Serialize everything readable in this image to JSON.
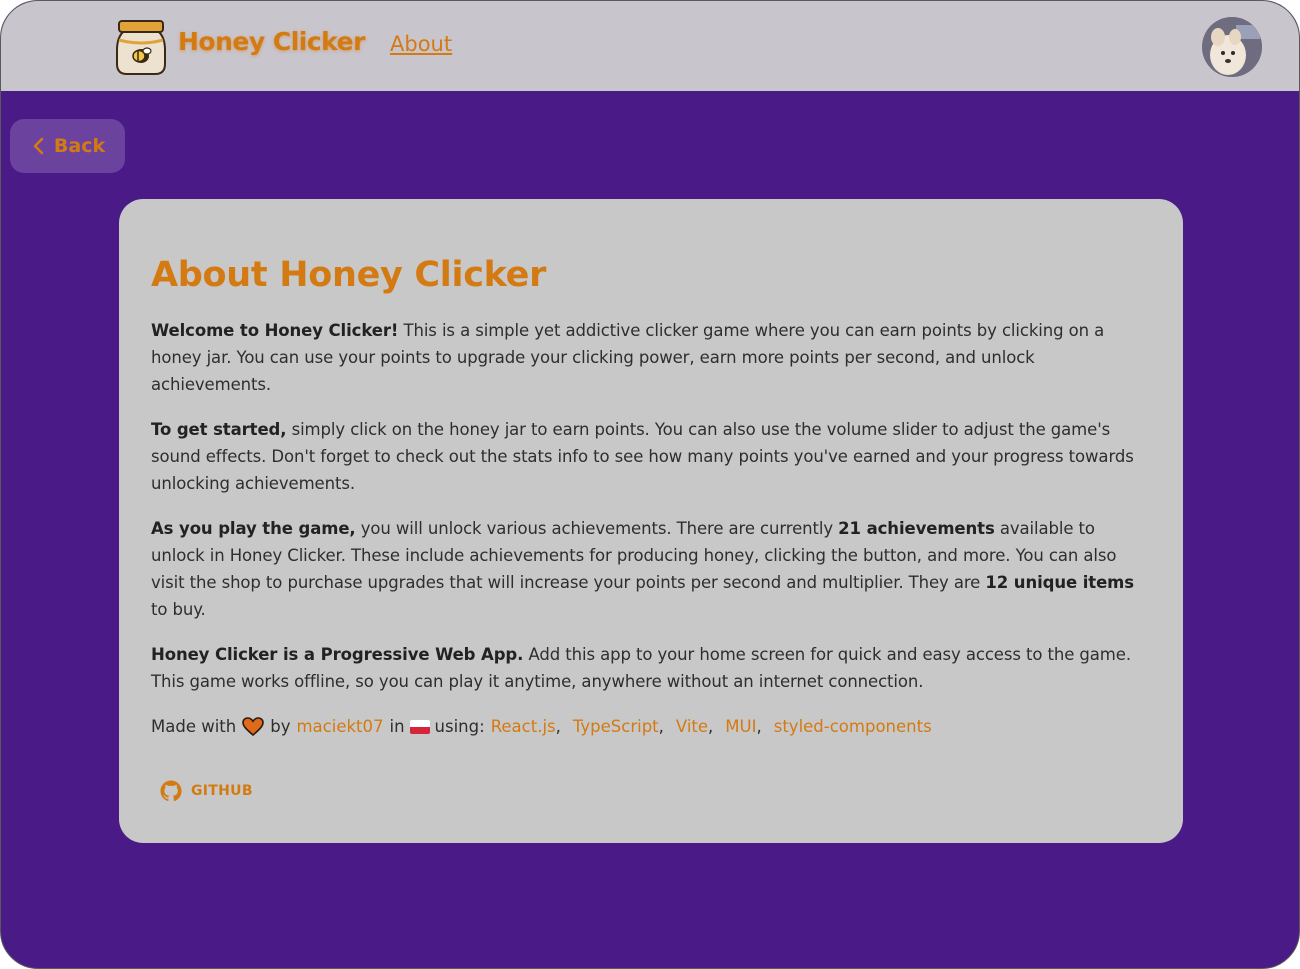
{
  "header": {
    "brand": "Honey Clicker",
    "nav_about": "About",
    "logo_icon": "honey-jar-bee-icon",
    "avatar_icon": "user-avatar"
  },
  "back_button": {
    "label": "Back",
    "icon": "chevron-left-icon"
  },
  "about": {
    "title": "About Honey Clicker",
    "p1": {
      "bold": "Welcome to Honey Clicker!",
      "text": " This is a simple yet addictive clicker game where you can earn points by clicking on a honey jar. You can use your points to upgrade your clicking power, earn more points per second, and unlock achievements."
    },
    "p2": {
      "bold": "To get started,",
      "text": " simply click on the honey jar to earn points. You can also use the volume slider to adjust the game's sound effects. Don't forget to check out the stats info to see how many points you've earned and your progress towards unlocking achievements."
    },
    "p3": {
      "bold1": "As you play the game,",
      "text1": " you will unlock various achievements. There are currently ",
      "bold2": "21 achievements",
      "text2": " available to unlock in Honey Clicker. These include achievements for producing honey, clicking the button, and more. You can also visit the shop to purchase upgrades that will increase your points per second and multiplier. They are ",
      "bold3": "12 unique items",
      "text3": " to buy."
    },
    "p4": {
      "bold": "Honey Clicker is a Progressive Web App.",
      "text": " Add this app to your home screen for quick and easy access to the game. This game works offline, so you can play it anytime, anywhere without an internet connection."
    },
    "made": {
      "made_with": "Made with",
      "by": "by",
      "author": "maciekt07",
      "in": "in",
      "using": "using:",
      "techs": [
        "React.js",
        "TypeScript",
        "Vite",
        "MUI",
        "styled-components"
      ],
      "separator": ","
    },
    "github_label": "GITHUB"
  },
  "colors": {
    "background": "#4a1a87",
    "header": "#c9c5cc",
    "card": "#c8c8c8",
    "accent": "#d47a12",
    "back_button": "#6b439e"
  }
}
